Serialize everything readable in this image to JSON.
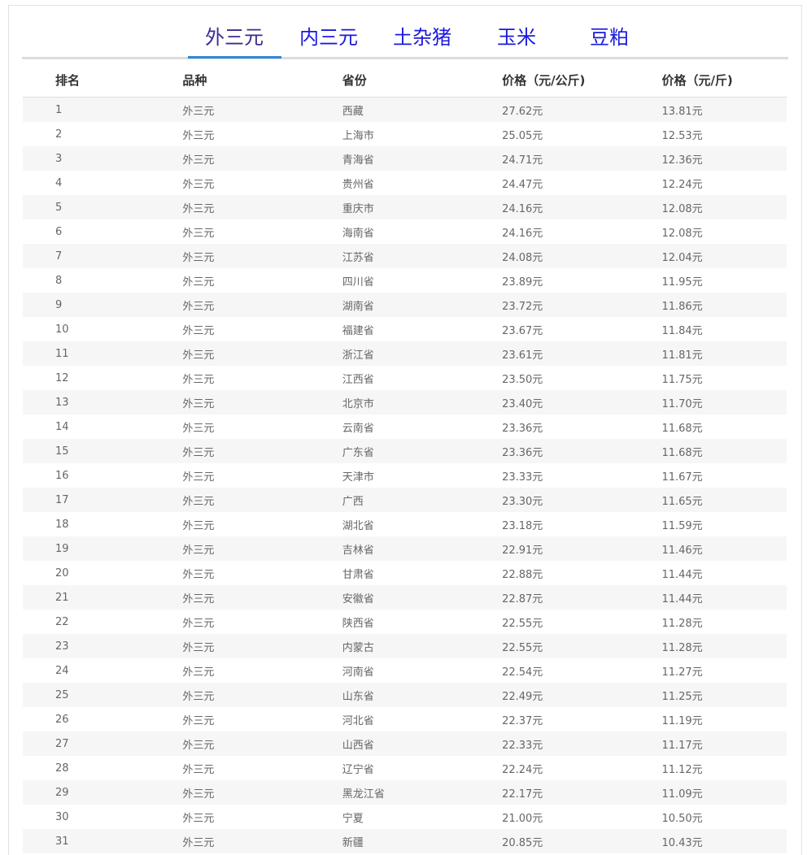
{
  "tabs": [
    {
      "label": "外三元",
      "active": true
    },
    {
      "label": "内三元",
      "active": false
    },
    {
      "label": "土杂猪",
      "active": false
    },
    {
      "label": "玉米",
      "active": false
    },
    {
      "label": "豆粕",
      "active": false
    }
  ],
  "table": {
    "headers": [
      "排名",
      "品种",
      "省份",
      "价格（元/公斤)",
      "价格（元/斤)"
    ],
    "rows": [
      [
        "1",
        "外三元",
        "西藏",
        "27.62元",
        "13.81元"
      ],
      [
        "2",
        "外三元",
        "上海市",
        "25.05元",
        "12.53元"
      ],
      [
        "3",
        "外三元",
        "青海省",
        "24.71元",
        "12.36元"
      ],
      [
        "4",
        "外三元",
        "贵州省",
        "24.47元",
        "12.24元"
      ],
      [
        "5",
        "外三元",
        "重庆市",
        "24.16元",
        "12.08元"
      ],
      [
        "6",
        "外三元",
        "海南省",
        "24.16元",
        "12.08元"
      ],
      [
        "7",
        "外三元",
        "江苏省",
        "24.08元",
        "12.04元"
      ],
      [
        "8",
        "外三元",
        "四川省",
        "23.89元",
        "11.95元"
      ],
      [
        "9",
        "外三元",
        "湖南省",
        "23.72元",
        "11.86元"
      ],
      [
        "10",
        "外三元",
        "福建省",
        "23.67元",
        "11.84元"
      ],
      [
        "11",
        "外三元",
        "浙江省",
        "23.61元",
        "11.81元"
      ],
      [
        "12",
        "外三元",
        "江西省",
        "23.50元",
        "11.75元"
      ],
      [
        "13",
        "外三元",
        "北京市",
        "23.40元",
        "11.70元"
      ],
      [
        "14",
        "外三元",
        "云南省",
        "23.36元",
        "11.68元"
      ],
      [
        "15",
        "外三元",
        "广东省",
        "23.36元",
        "11.68元"
      ],
      [
        "16",
        "外三元",
        "天津市",
        "23.33元",
        "11.67元"
      ],
      [
        "17",
        "外三元",
        "广西",
        "23.30元",
        "11.65元"
      ],
      [
        "18",
        "外三元",
        "湖北省",
        "23.18元",
        "11.59元"
      ],
      [
        "19",
        "外三元",
        "吉林省",
        "22.91元",
        "11.46元"
      ],
      [
        "20",
        "外三元",
        "甘肃省",
        "22.88元",
        "11.44元"
      ],
      [
        "21",
        "外三元",
        "安徽省",
        "22.87元",
        "11.44元"
      ],
      [
        "22",
        "外三元",
        "陕西省",
        "22.55元",
        "11.28元"
      ],
      [
        "23",
        "外三元",
        "内蒙古",
        "22.55元",
        "11.28元"
      ],
      [
        "24",
        "外三元",
        "河南省",
        "22.54元",
        "11.27元"
      ],
      [
        "25",
        "外三元",
        "山东省",
        "22.49元",
        "11.25元"
      ],
      [
        "26",
        "外三元",
        "河北省",
        "22.37元",
        "11.19元"
      ],
      [
        "27",
        "外三元",
        "山西省",
        "22.33元",
        "11.17元"
      ],
      [
        "28",
        "外三元",
        "辽宁省",
        "22.24元",
        "11.12元"
      ],
      [
        "29",
        "外三元",
        "黑龙江省",
        "22.17元",
        "11.09元"
      ],
      [
        "30",
        "外三元",
        "宁夏",
        "21.00元",
        "10.50元"
      ],
      [
        "31",
        "外三元",
        "新疆",
        "20.85元",
        "10.43元"
      ]
    ]
  },
  "colors": {
    "tab_text": "#1a1adc",
    "tab_active_text": "#3b2a8f",
    "tab_underline": "#2d8ad8",
    "stripe": "#f6f6f6"
  }
}
